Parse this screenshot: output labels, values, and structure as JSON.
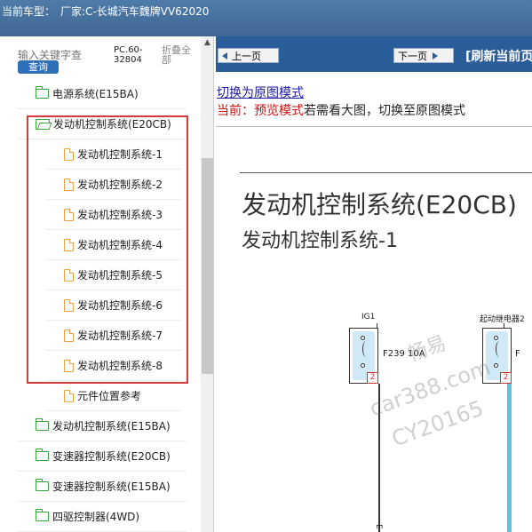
{
  "titlebar": {
    "prefix": "当前车型：",
    "vehicle": "厂家:C-长城汽车魏牌VV62020"
  },
  "sidebar": {
    "search_placeholder": "输入关键字查",
    "query_label": "查询",
    "model_code": "PC.60-32804",
    "collapse_label": "折叠全部",
    "items": [
      {
        "label": "电源系统(E15BA)",
        "icon": "folder-icon"
      },
      {
        "label": "发动机控制系统(E20CB)",
        "icon": "folder-open-icon"
      },
      {
        "label": "发动机控制系统-1",
        "icon": "document-icon"
      },
      {
        "label": "发动机控制系统-2",
        "icon": "document-icon"
      },
      {
        "label": "发动机控制系统-3",
        "icon": "document-icon"
      },
      {
        "label": "发动机控制系统-4",
        "icon": "document-icon"
      },
      {
        "label": "发动机控制系统-5",
        "icon": "document-icon"
      },
      {
        "label": "发动机控制系统-6",
        "icon": "document-icon"
      },
      {
        "label": "发动机控制系统-7",
        "icon": "document-icon"
      },
      {
        "label": "发动机控制系统-8",
        "icon": "document-icon"
      },
      {
        "label": "元件位置参考",
        "icon": "document-icon"
      },
      {
        "label": "发动机控制系统(E15BA)",
        "icon": "folder-icon"
      },
      {
        "label": "变速器控制系统(E20CB)",
        "icon": "folder-icon"
      },
      {
        "label": "变速器控制系统(E15BA)",
        "icon": "folder-icon"
      },
      {
        "label": "四驱控制器(4WD)",
        "icon": "folder-icon"
      }
    ]
  },
  "toolbar": {
    "prev_label": "上一页",
    "next_label": "下一页",
    "refresh_label": "[刷新当前页"
  },
  "mode": {
    "switch_link": "切换为原图模式",
    "current_prefix": "当前：",
    "current_mode": "预览模式",
    "hint": "若需看大图，切换至原图模式"
  },
  "document": {
    "title": "发动机控制系统(E20CB)",
    "subtitle": "发动机控制系统-1",
    "components": [
      {
        "label": "IG1",
        "fuse": "F239 10A",
        "pin": "2"
      },
      {
        "label": "起动继电器2",
        "fuse": "F",
        "pin": "2"
      }
    ],
    "wire_label": "E",
    "watermark_lines": [
      "畅易",
      "car388.com",
      "CY20165"
    ]
  },
  "colors": {
    "titlebar": "#4f7ba8",
    "navbar": "#2b5d9a",
    "highlight": "#d63a3a",
    "folder": "#3aa53a",
    "doc": "#f0a04a",
    "wire": "#5fc0df"
  }
}
